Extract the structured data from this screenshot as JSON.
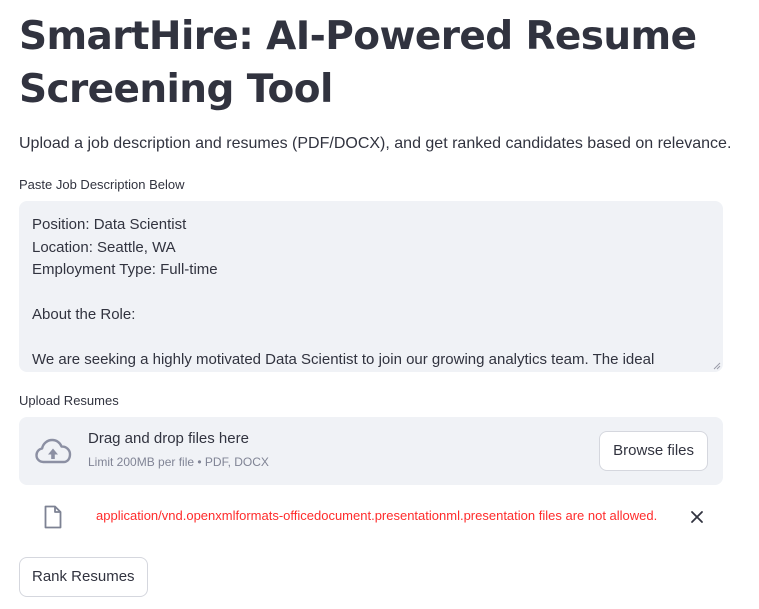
{
  "app": {
    "title": "SmartHire: AI-Powered Resume Screening Tool",
    "subtitle": "Upload a job description and resumes (PDF/DOCX), and get ranked candidates based on relevance."
  },
  "job_description": {
    "label": "Paste Job Description Below",
    "lines": [
      "Position: Data Scientist",
      "Location: Seattle, WA",
      "Employment Type: Full-time",
      "",
      "About the Role:",
      "",
      "We are seeking a highly motivated Data Scientist to join our growing analytics team. The ideal"
    ]
  },
  "upload": {
    "label": "Upload Resumes",
    "drag_text": "Drag and drop files here",
    "limit_text": "Limit 200MB per file • PDF, DOCX",
    "browse_label": "Browse files",
    "upload_icon": "cloud-upload-icon"
  },
  "uploaded_file": {
    "file_icon": "file-icon",
    "error_message": "application/vnd.openxmlformats-officedocument.presentationml.presentation files are not allowed.",
    "remove_icon": "close-icon"
  },
  "actions": {
    "rank_label": "Rank Resumes"
  },
  "colors": {
    "text": "#31333f",
    "input_background": "#f0f2f6",
    "muted_text": "#808495",
    "error": "#ff2b2b",
    "border": "#d5d7de"
  }
}
